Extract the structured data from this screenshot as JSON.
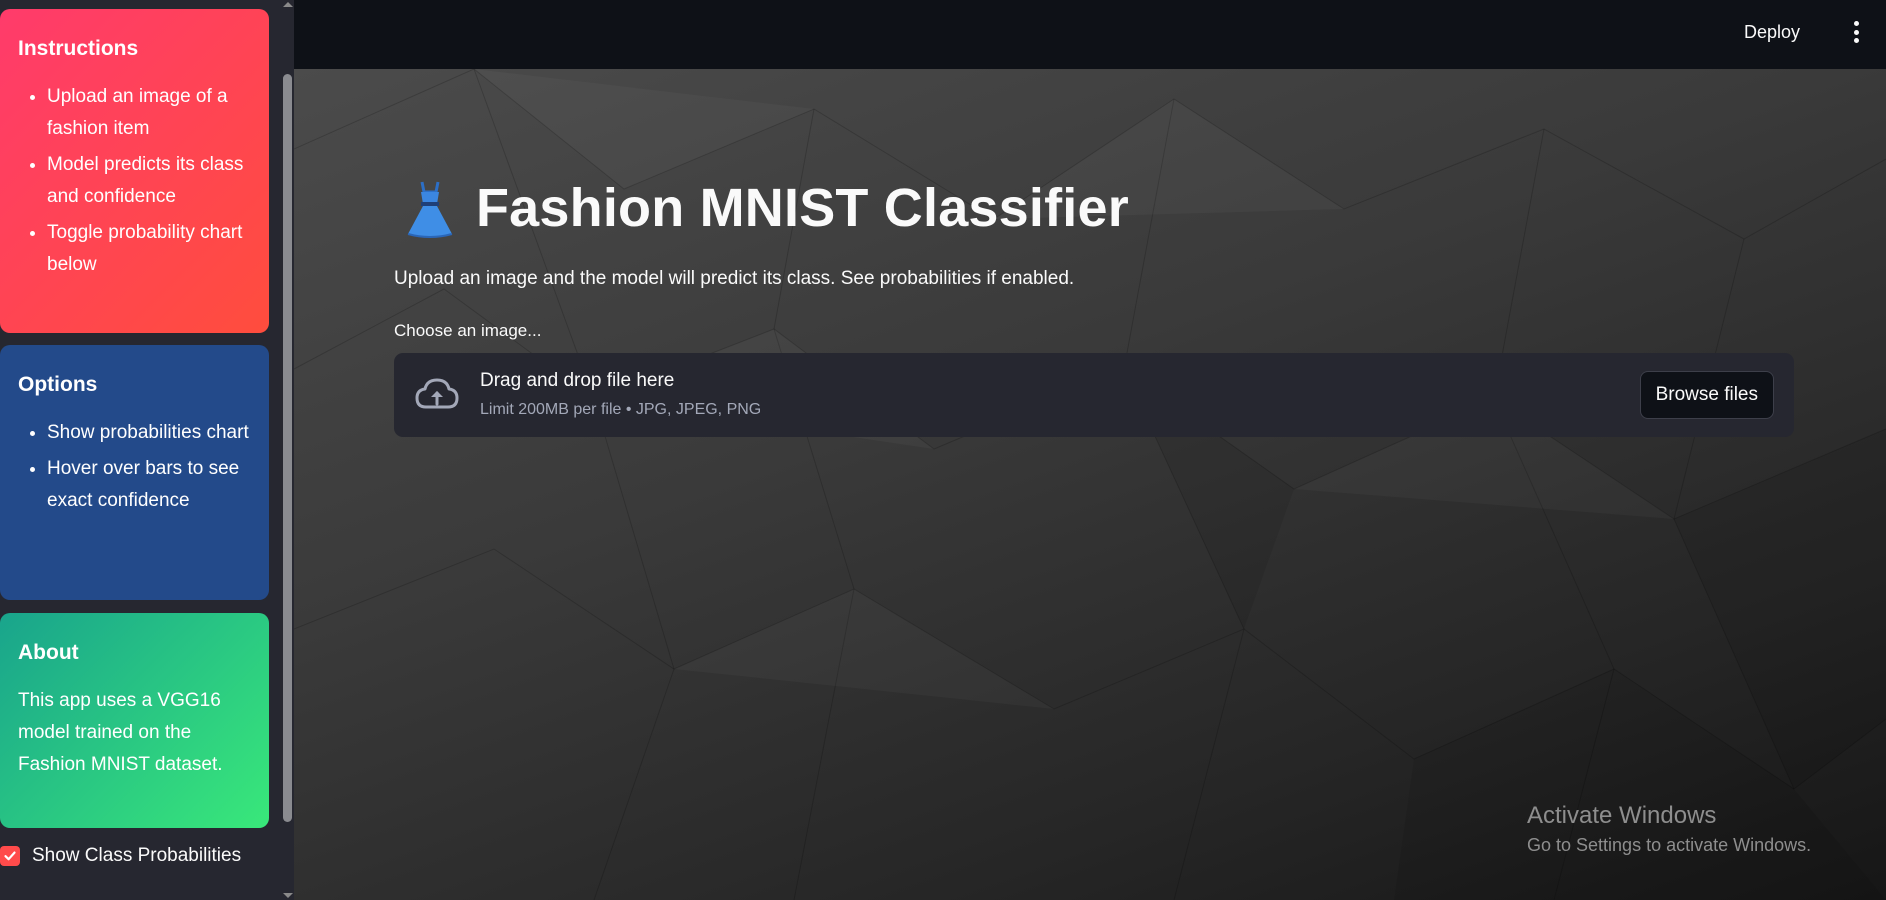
{
  "sidebar": {
    "instructions": {
      "heading": "Instructions",
      "items": [
        "Upload an image of a fashion item",
        "Model predicts its class and confidence",
        "Toggle probability chart below"
      ]
    },
    "options": {
      "heading": "Options",
      "items": [
        "Show probabilities chart",
        "Hover over bars to see exact confidence"
      ]
    },
    "about": {
      "heading": "About",
      "text": "This app uses a VGG16 model trained on the Fashion MNIST dataset."
    },
    "checkbox": {
      "label": "Show Class Probabilities",
      "checked": true
    }
  },
  "header": {
    "deploy_label": "Deploy"
  },
  "main": {
    "title": "Fashion MNIST Classifier",
    "title_icon": "dress-icon",
    "subtitle": "Upload an image and the model will predict its class. See probabilities if enabled.",
    "uploader": {
      "label": "Choose an image...",
      "drop_title": "Drag and drop file here",
      "limit": "Limit 200MB per file • JPG, JPEG, PNG",
      "browse_label": "Browse files"
    }
  },
  "watermark": {
    "title": "Activate Windows",
    "subtitle": "Go to Settings to activate Windows."
  },
  "colors": {
    "accent": "#ff4b4b",
    "instructions_card": "#ff3b6b",
    "options_card": "#234a8a",
    "about_card": "#2fd27e",
    "sidebar_bg": "#262730",
    "header_bg": "#0e1117"
  }
}
